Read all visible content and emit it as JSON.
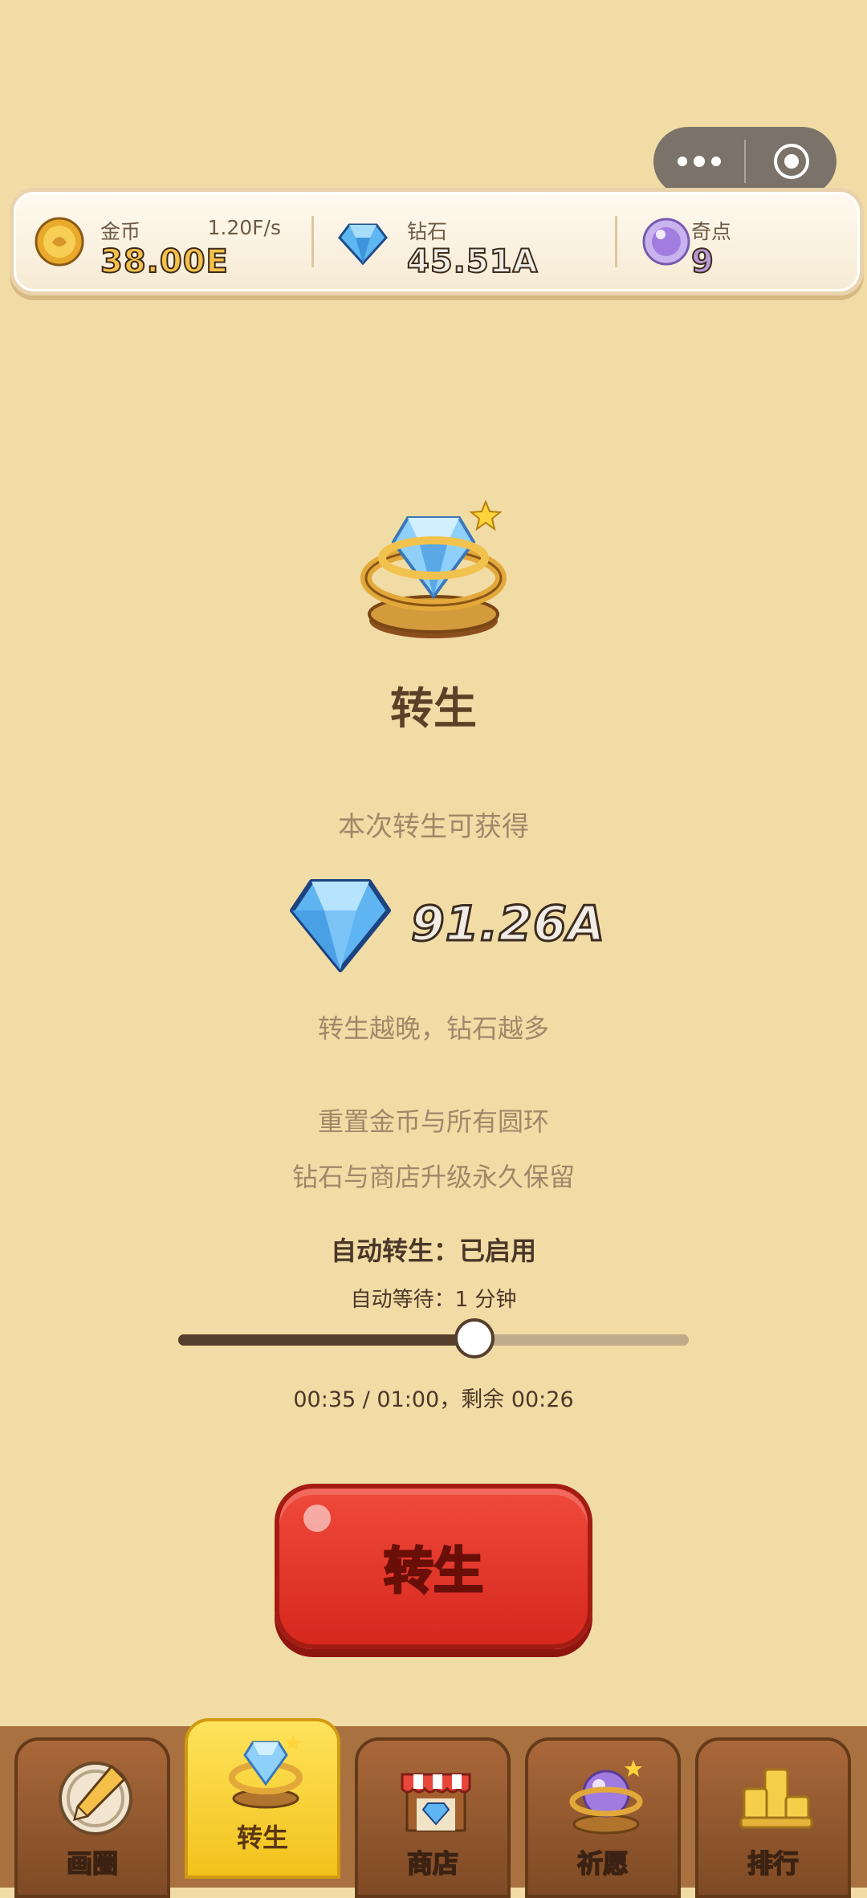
{
  "capsule": {
    "more_icon": "more-dots-icon",
    "close_icon": "target-close-icon"
  },
  "resources": {
    "coin": {
      "label": "金币",
      "rate": "1.20F/s",
      "value": "38.00E",
      "icon": "coin-icon"
    },
    "diamond": {
      "label": "钻石",
      "value": "45.51A",
      "icon": "diamond-icon"
    },
    "singularity": {
      "label": "奇点",
      "value": "9",
      "icon": "purple-orb-icon"
    }
  },
  "rebirth": {
    "title": "转生",
    "gain_label": "本次转生可获得",
    "gain_value": "91.26A",
    "tip": "转生越晚，钻石越多",
    "reset_note": "重置金币与所有圆环",
    "keep_note": "钻石与商店升级永久保留",
    "auto_status": "自动转生：已启用",
    "auto_wait": "自动等待：1 分钟",
    "slider_progress": 0.58,
    "timer": "00:35 / 01:00，剩余 00:26",
    "button_label": "转生"
  },
  "nav": {
    "tabs": [
      {
        "label": "画圈",
        "icon": "pencil-icon",
        "active": false
      },
      {
        "label": "转生",
        "icon": "diamond-ring-icon",
        "active": true
      },
      {
        "label": "商店",
        "icon": "shop-icon",
        "active": false
      },
      {
        "label": "祈愿",
        "icon": "purple-orb-icon",
        "active": false
      },
      {
        "label": "排行",
        "icon": "podium-icon",
        "active": false
      }
    ]
  },
  "colors": {
    "background": "#f2dca6",
    "button": "#e0342a",
    "active_tab": "#f7cf2a"
  }
}
